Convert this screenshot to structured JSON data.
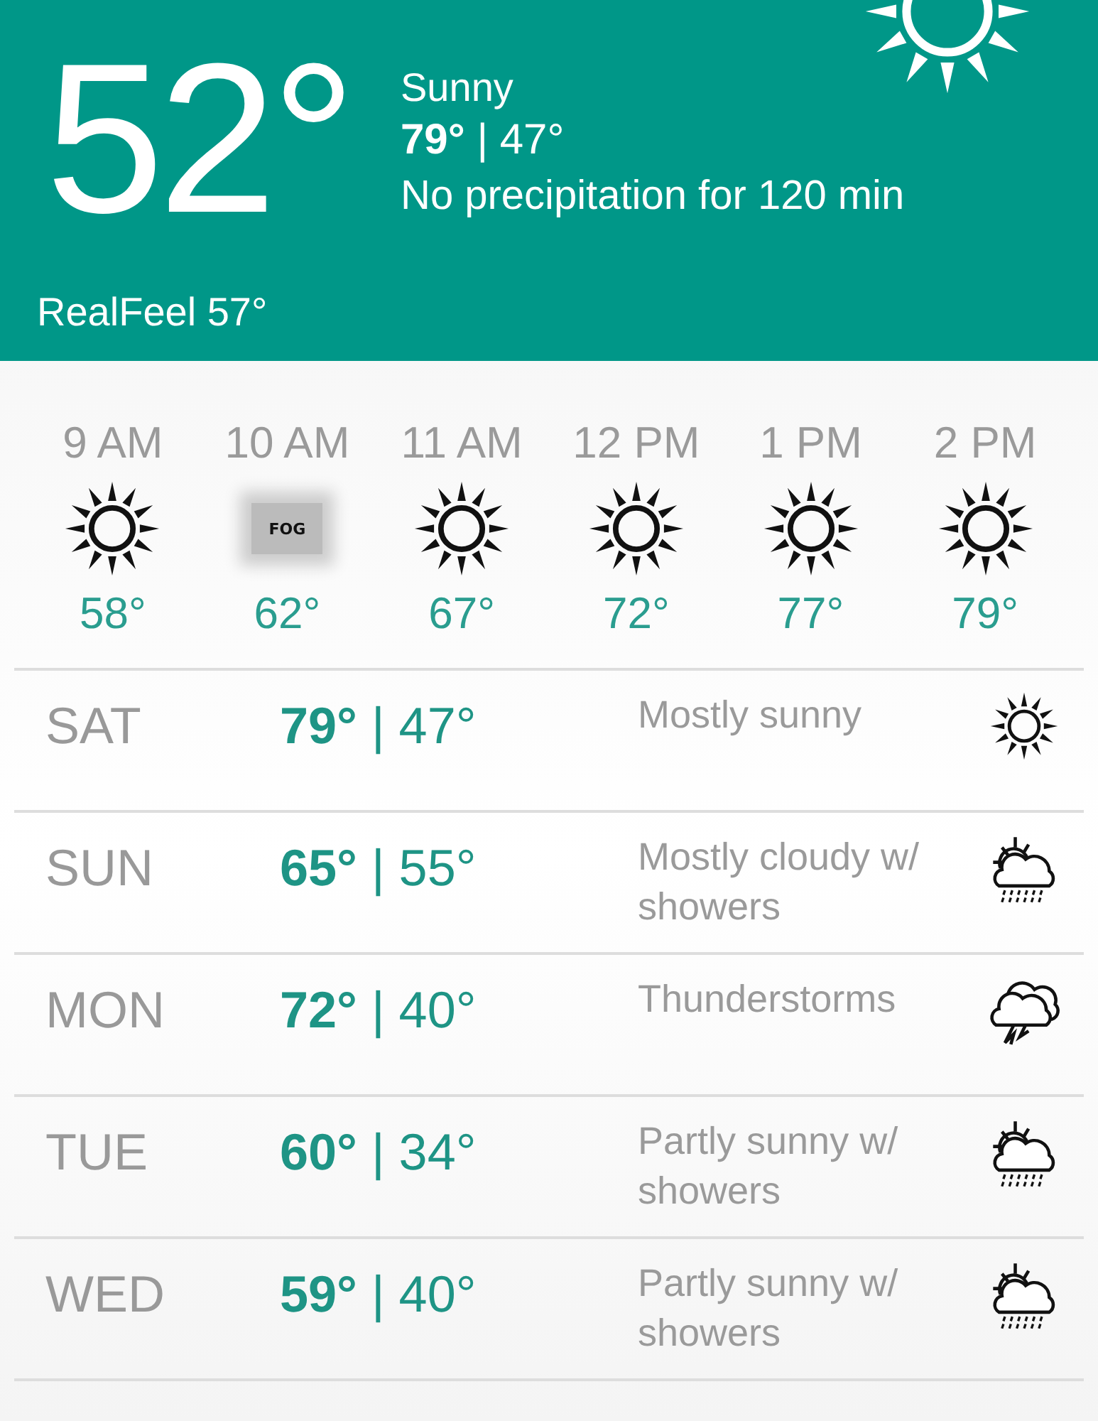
{
  "current": {
    "temperature": "52°",
    "condition": "Sunny",
    "hi_lo": "**79°** | 47°",
    "precipitation": "No precipitation for 120 min",
    "realfeel": "RealFeel 57°"
  },
  "hourly": [
    {
      "time": "9 AM",
      "kind": "sun",
      "temperature": "58°"
    },
    {
      "time": "10 AM",
      "kind": "fog",
      "icon_text": "FOG",
      "temperature": "62°"
    },
    {
      "time": "11 AM",
      "kind": "sun",
      "temperature": "67°"
    },
    {
      "time": "12 PM",
      "kind": "sun",
      "temperature": "72°"
    },
    {
      "time": "1 PM",
      "kind": "sun",
      "temperature": "77°"
    },
    {
      "time": "2 PM",
      "kind": "sun",
      "temperature": "79°"
    }
  ],
  "daily": [
    {
      "day": "SAT",
      "hi_lo": "**79°** | 47°",
      "description": "Mostly sunny",
      "kind": "sun"
    },
    {
      "day": "SUN",
      "hi_lo": "**65°** | 55°",
      "description": "Mostly cloudy w/ showers",
      "kind": "showers"
    },
    {
      "day": "MON",
      "hi_lo": "**72°** | 40°",
      "description": "Thunderstorms",
      "kind": "storm"
    },
    {
      "day": "TUE",
      "hi_lo": "**60°** | 34°",
      "description": "Partly sunny w/ showers",
      "kind": "showers"
    },
    {
      "day": "WED",
      "hi_lo": "**59°** | 40°",
      "description": "Partly sunny w/ showers",
      "kind": "showers"
    }
  ]
}
